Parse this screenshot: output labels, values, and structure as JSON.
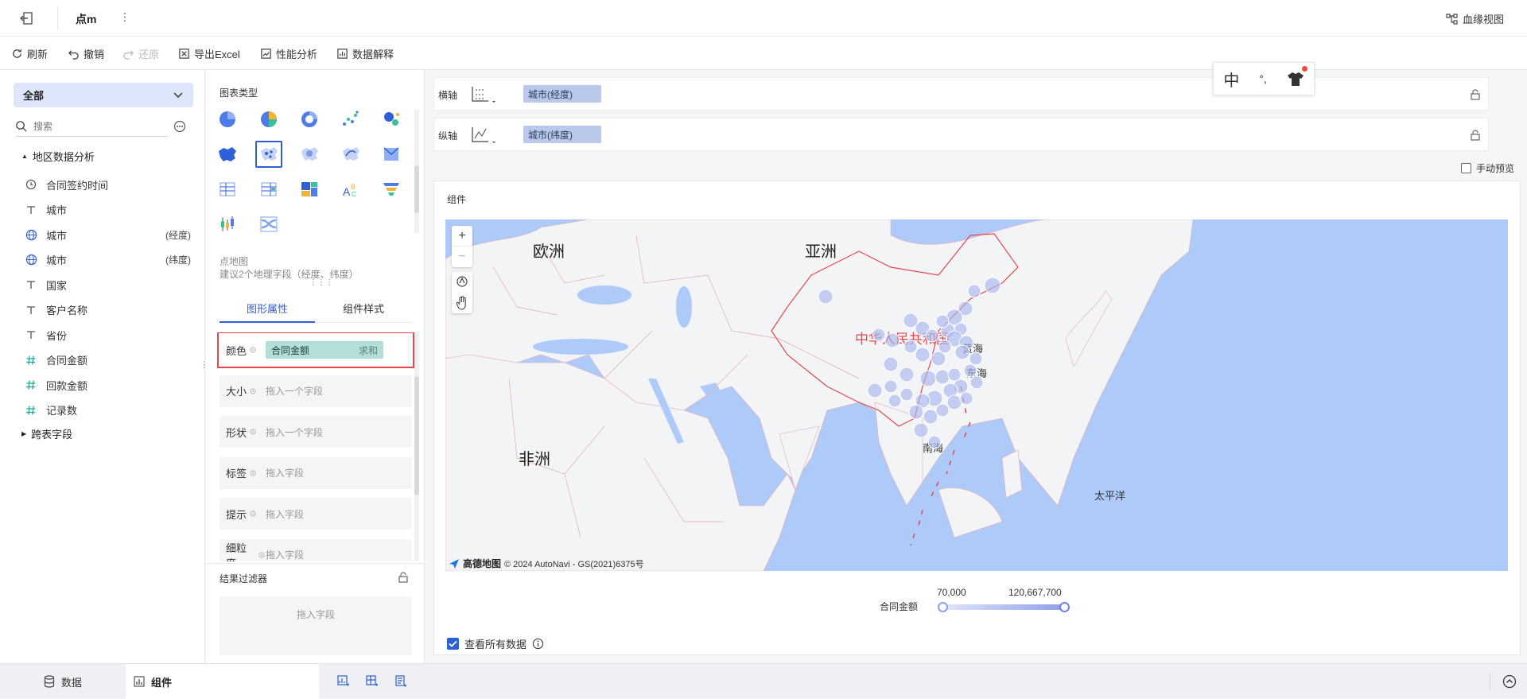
{
  "header": {
    "title": "点m",
    "lineage_label": "血缘视图"
  },
  "toolbar": {
    "refresh": "刷新",
    "undo": "撤销",
    "redo": "还原",
    "export_excel": "导出Excel",
    "perf_analysis": "性能分析",
    "data_explain": "数据解释"
  },
  "left": {
    "scope_select": "全部",
    "search_placeholder": "搜索",
    "group_title": "地区数据分析",
    "fields": [
      {
        "name": "合同签约时间",
        "icon": "clock-icon",
        "suffix": ""
      },
      {
        "name": "城市",
        "icon": "text-type-icon",
        "suffix": ""
      },
      {
        "name": "城市",
        "icon": "globe-icon",
        "suffix": "(经度)"
      },
      {
        "name": "城市",
        "icon": "globe-icon",
        "suffix": "(纬度)"
      },
      {
        "name": "国家",
        "icon": "text-type-icon",
        "suffix": ""
      },
      {
        "name": "客户名称",
        "icon": "text-type-icon",
        "suffix": ""
      },
      {
        "name": "省份",
        "icon": "text-type-icon",
        "suffix": ""
      },
      {
        "name": "合同金额",
        "icon": "number-type-icon",
        "suffix": ""
      },
      {
        "name": "回款金额",
        "icon": "number-type-icon",
        "suffix": ""
      },
      {
        "name": "记录数",
        "icon": "number-type-icon",
        "suffix": ""
      }
    ],
    "cross_table": "跨表字段"
  },
  "middle": {
    "chart_type_title": "图表类型",
    "chart_name": "点地图",
    "chart_hint": "建议2个地理字段（经度、纬度）",
    "tab_shape": "图形属性",
    "tab_style": "组件样式",
    "props": [
      {
        "label": "颜色",
        "value": "合同金额",
        "agg": "求和"
      },
      {
        "label": "大小",
        "placeholder": "拖入一个字段"
      },
      {
        "label": "形状",
        "placeholder": "拖入一个字段"
      },
      {
        "label": "标签",
        "placeholder": "拖入字段"
      },
      {
        "label": "提示",
        "placeholder": "拖入字段"
      },
      {
        "label": "细粒度",
        "placeholder": "拖入字段"
      }
    ],
    "filter_title": "结果过滤器",
    "filter_placeholder": "拖入字段"
  },
  "axes": {
    "x_label": "横轴",
    "x_field": "城市(经度)",
    "y_label": "纵轴",
    "y_field": "城市(纬度)",
    "manual_preview": "手动预览"
  },
  "widget": {
    "title": "组件",
    "map_labels": {
      "europe": "欧洲",
      "asia": "亚洲",
      "africa": "非洲",
      "china": "中华人民共和国",
      "yellow_sea": "黄海",
      "east_sea": "东海",
      "south_sea": "南海",
      "pacific": "太平洋"
    },
    "attribution_brand": "高德地图",
    "attribution_text": "© 2024 AutoNavi - GS(2021)6375号",
    "legend_label": "合同金额",
    "legend_min": "70,000",
    "legend_max": "120,667,700",
    "view_all": "查看所有数据"
  },
  "ime": {
    "lang": "中",
    "punct": "°,"
  },
  "bottom": {
    "tab_data": "数据",
    "tab_widget": "组件"
  },
  "colors": {
    "accent": "#2f5fd6",
    "pill": "#b9c8eb",
    "color_pill": "#b2e0d8",
    "sea": "#aecaf9",
    "land": "#f3f4f6",
    "border_red": "#e5484d",
    "point": "#a9b8ee"
  }
}
